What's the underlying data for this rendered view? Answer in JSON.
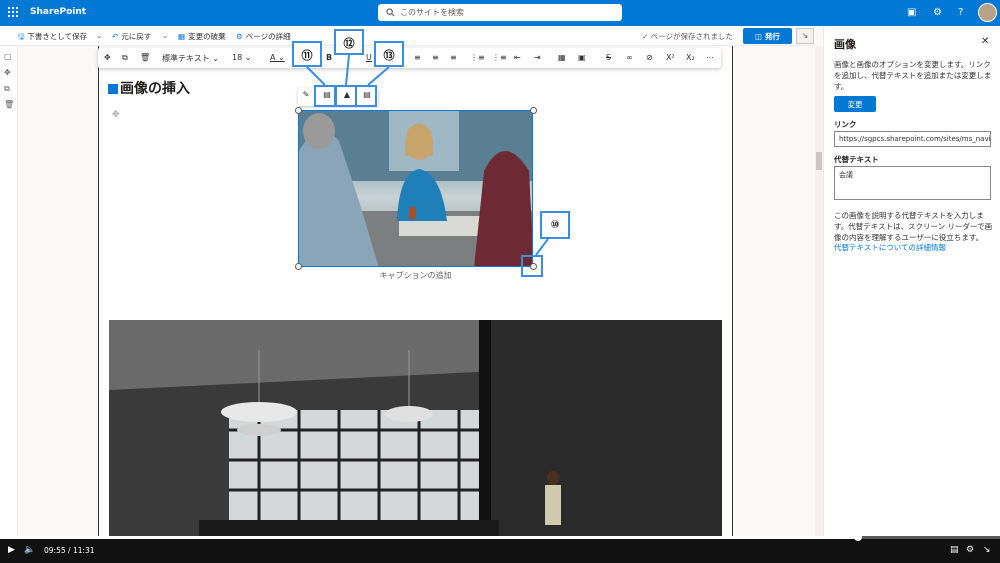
{
  "suite": {
    "app_name": "SharePoint",
    "search_placeholder": "このサイトを検索"
  },
  "command_bar": {
    "save_draft": "下書きとして保存",
    "undo": "元に戻す",
    "discard": "変更の破棄",
    "page_details": "ページの詳細",
    "saved_status": "ページが保存されました",
    "publish": "発行"
  },
  "editor_toolbar": {
    "style": "標準テキスト",
    "font_size": "18"
  },
  "page": {
    "heading": "画像の挿入",
    "caption": "キャプションの追加"
  },
  "callouts": [
    "⑪",
    "⑫",
    "⑬",
    "⑩"
  ],
  "panel": {
    "title": "画像",
    "description": "画像と画像のオプションを変更します。リンクを追加し、代替テキストを追加または変更します。",
    "change_button": "変更",
    "link_label": "リンク",
    "link_value": "https://sgpcs.sharepoint.com/sites/ms_navi/...",
    "alt_label": "代替テキスト",
    "alt_value": "会議",
    "help_text": "この画像を説明する代替テキストを入力します。代替テキストは、スクリーン リーダーで画像の内容を理解するユーザーに役立ちます。",
    "more_info_link": "代替テキストについての詳細情報"
  },
  "player": {
    "current_time": "09:55",
    "separator": "/",
    "total_time": "11:31",
    "progress_fraction": 0.858
  },
  "colors": {
    "accent": "#0078d4",
    "callout_border": "#3a8edc"
  }
}
